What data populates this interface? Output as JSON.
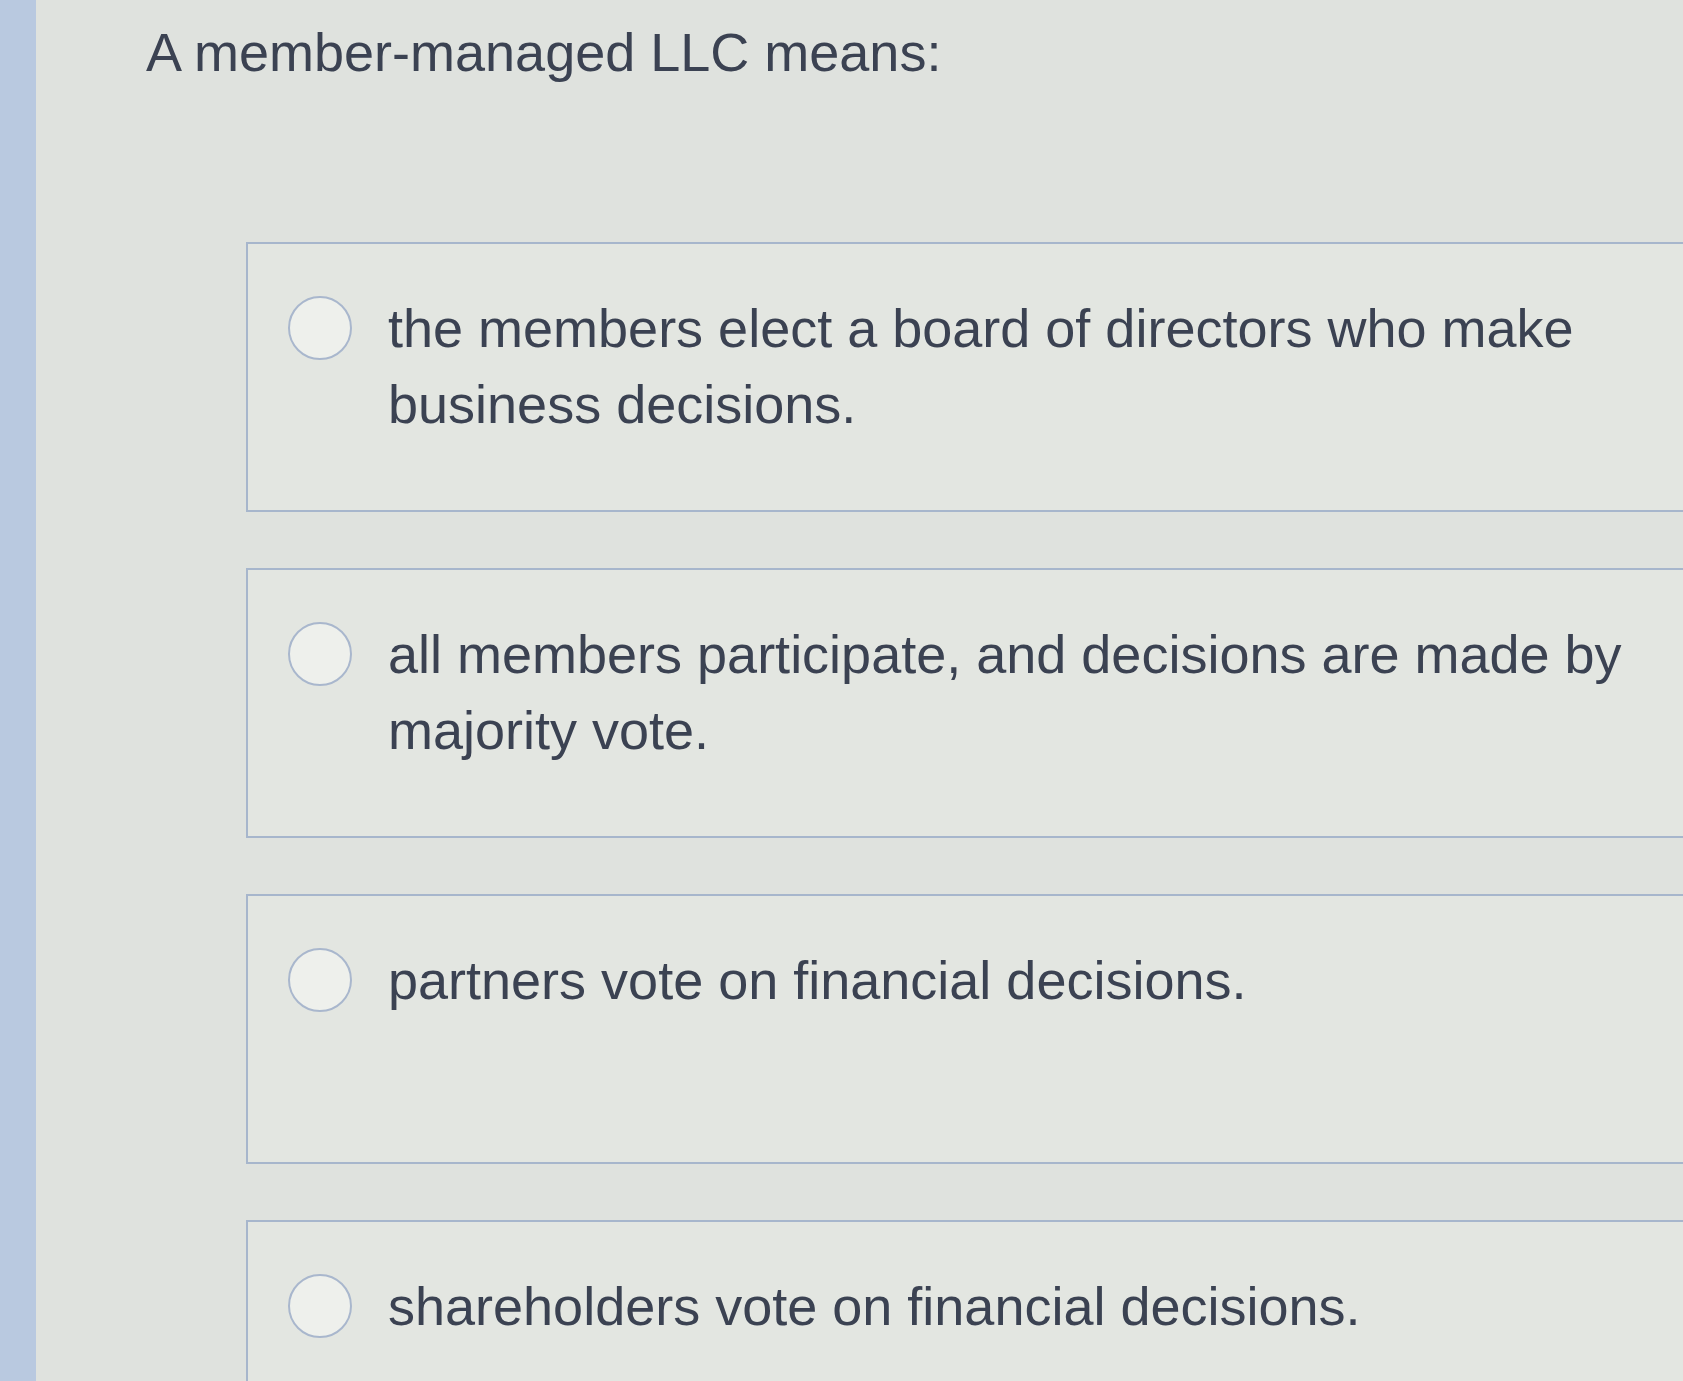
{
  "question": "A member-managed LLC means:",
  "options": [
    {
      "label": "the members elect a board of directors who make business decisions.",
      "selected": false
    },
    {
      "label": "all members participate, and decisions are made by majority vote.",
      "selected": false
    },
    {
      "label": "partners vote on financial decisions.",
      "selected": false
    },
    {
      "label": "shareholders vote on financial decisions.",
      "selected": false
    }
  ]
}
